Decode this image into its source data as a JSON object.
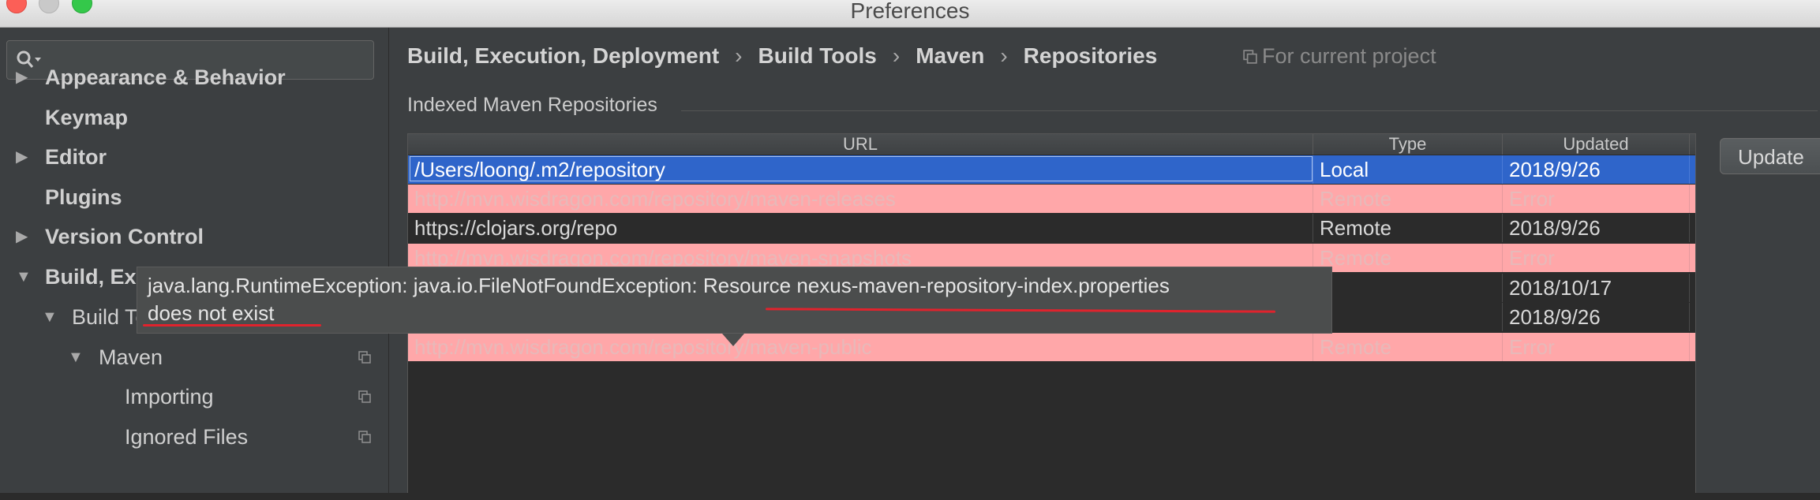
{
  "window": {
    "title": "Preferences"
  },
  "search": {
    "placeholder": ""
  },
  "sidebar": {
    "items": [
      {
        "label": "Appearance & Behavior",
        "expandable": "▶"
      },
      {
        "label": "Keymap"
      },
      {
        "label": "Editor",
        "expandable": "▶"
      },
      {
        "label": "Plugins"
      },
      {
        "label": "Version Control",
        "expandable": "▶"
      },
      {
        "label": "Build, Execution, Deployment",
        "expandable": "▼"
      },
      {
        "label": "Build Tools",
        "expandable": "▼"
      },
      {
        "label": "Maven",
        "expandable": "▼"
      },
      {
        "label": "Importing"
      },
      {
        "label": "Ignored Files"
      }
    ]
  },
  "breadcrumb": [
    "Build, Execution, Deployment",
    "Build Tools",
    "Maven",
    "Repositories"
  ],
  "breadcrumb_sep": "›",
  "scope_label": "For current project",
  "section_label": "Indexed Maven Repositories",
  "table": {
    "columns": [
      "URL",
      "Type",
      "Updated"
    ],
    "rows": [
      {
        "url": "/Users/loong/.m2/repository",
        "type": "Local",
        "updated": "2018/9/26",
        "state": "selected"
      },
      {
        "url": "http://mvn.wisdragon.com/repository/maven-releases",
        "type": "Remote",
        "updated": "Error",
        "state": "error"
      },
      {
        "url": "https://clojars.org/repo",
        "type": "Remote",
        "updated": "2018/9/26",
        "state": "plain"
      },
      {
        "url": "http://mvn.wisdragon.com/repository/maven-snapshots",
        "type": "Remote",
        "updated": "Error",
        "state": "error"
      },
      {
        "url": "",
        "type": "",
        "updated": "2018/10/17",
        "state": "plain"
      },
      {
        "url": "",
        "type": "",
        "updated": "2018/9/26",
        "state": "plain"
      },
      {
        "url": "http://mvn.wisdragon.com/repository/maven-public",
        "type": "Remote",
        "updated": "Error",
        "state": "error"
      }
    ]
  },
  "update_button": "Update",
  "tooltip": {
    "line1": "java.lang.RuntimeException: java.io.FileNotFoundException: Resource nexus-maven-repository-index.properties",
    "line2": "does not exist"
  },
  "colors": {
    "selection": "#2f65ca",
    "error_row": "#ffa7a9",
    "annotation": "#e0232d"
  }
}
